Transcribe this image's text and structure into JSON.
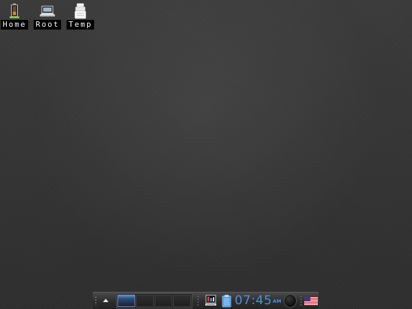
{
  "desktop": {
    "icons": [
      {
        "label": "Home",
        "icon": "home-battery-icon"
      },
      {
        "label": "Root",
        "icon": "laptop-drive-icon"
      },
      {
        "label": "Temp",
        "icon": "temp-folder-icon"
      }
    ]
  },
  "taskbar": {
    "menu_icon": "up-arrow-icon",
    "pager": {
      "count": 4,
      "active": 1
    },
    "tray": {
      "icons": [
        "network-monitor-icon",
        "clipboard-icon",
        "volume-knob-icon",
        "us-flag-icon"
      ],
      "clock": {
        "time": "07:45",
        "ampm": "AM"
      }
    }
  },
  "colors": {
    "clock_text": "#4a8fe0",
    "active_desktop": "#5b8fd4",
    "label_bg": "#000000"
  }
}
